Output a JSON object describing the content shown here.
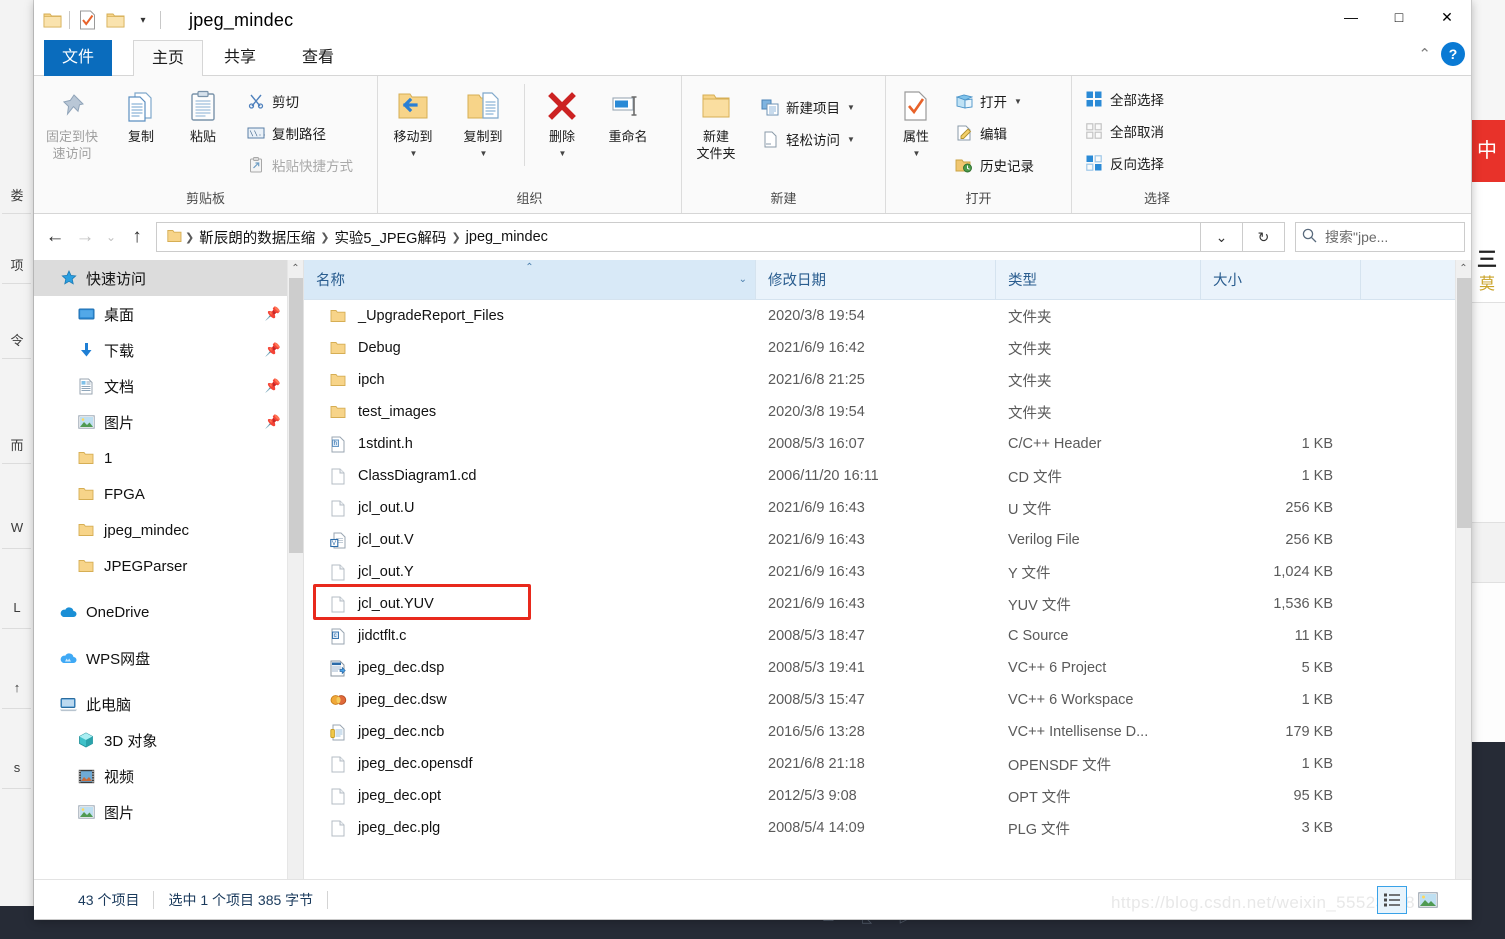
{
  "window": {
    "title": "jpeg_mindec",
    "quick_access_icons": [
      "folder-icon",
      "properties-icon",
      "folder-icon",
      "chevron-down-icon"
    ],
    "controls": {
      "minimize": "—",
      "maximize": "□",
      "close": "✕"
    }
  },
  "ribbon": {
    "tabs": [
      {
        "label": "文件",
        "kind": "file",
        "active": false
      },
      {
        "label": "主页",
        "kind": "normal",
        "active": true
      },
      {
        "label": "共享",
        "kind": "normal",
        "active": false
      },
      {
        "label": "查看",
        "kind": "normal",
        "active": false
      }
    ],
    "collapse_icon": "chevron-up-icon",
    "help_icon": "help-icon",
    "help_label": "?",
    "groups": [
      {
        "name": "clipboard",
        "label": "剪贴板",
        "big": [
          {
            "label": "固定到快\n速访问",
            "line1": "固定到快",
            "line2": "速访问",
            "icon": "pin-icon",
            "dim": true
          },
          {
            "label": "复制",
            "line1": "复制",
            "line2": "",
            "icon": "copy-icon",
            "dim": false
          },
          {
            "label": "粘贴",
            "line1": "粘贴",
            "line2": "",
            "icon": "paste-icon",
            "dim": false
          }
        ],
        "small": [
          {
            "label": "剪切",
            "icon": "scissors-icon",
            "dim": false
          },
          {
            "label": "复制路径",
            "icon": "copy-path-icon",
            "dim": false
          },
          {
            "label": "粘贴快捷方式",
            "icon": "paste-shortcut-icon",
            "dim": true
          }
        ]
      },
      {
        "name": "organize",
        "label": "组织",
        "big": [
          {
            "label": "移动到",
            "line1": "移动到",
            "line2": "",
            "icon": "move-to-icon",
            "dropdown": true
          },
          {
            "label": "复制到",
            "line1": "复制到",
            "line2": "",
            "icon": "copy-to-icon",
            "dropdown": true
          },
          {
            "label": "删除",
            "line1": "删除",
            "line2": "",
            "icon": "delete-icon",
            "dropdown": true
          },
          {
            "label": "重命名",
            "line1": "重命名",
            "line2": "",
            "icon": "rename-icon",
            "dropdown": false
          }
        ],
        "small": []
      },
      {
        "name": "new",
        "label": "新建",
        "big": [
          {
            "label": "新建\n文件夹",
            "line1": "新建",
            "line2": "文件夹",
            "icon": "new-folder-icon",
            "dim": false
          }
        ],
        "small": [
          {
            "label": "新建项目",
            "icon": "new-item-icon",
            "dropdown": true
          },
          {
            "label": "轻松访问",
            "icon": "easy-access-icon",
            "dropdown": true
          }
        ]
      },
      {
        "name": "open",
        "label": "打开",
        "big": [
          {
            "label": "属性",
            "line1": "属性",
            "line2": "",
            "icon": "properties-icon",
            "dropdown": true
          }
        ],
        "small": [
          {
            "label": "打开",
            "icon": "open-icon",
            "dropdown": true
          },
          {
            "label": "编辑",
            "icon": "edit-icon",
            "dropdown": false
          },
          {
            "label": "历史记录",
            "icon": "history-icon",
            "dropdown": false
          }
        ]
      },
      {
        "name": "select",
        "label": "选择",
        "big": [],
        "small": [
          {
            "label": "全部选择",
            "icon": "select-all-icon",
            "dim": false
          },
          {
            "label": "全部取消",
            "icon": "select-none-icon",
            "dim": true
          },
          {
            "label": "反向选择",
            "icon": "invert-selection-icon",
            "dim": false
          }
        ]
      }
    ]
  },
  "address": {
    "back_icon": "arrow-left-icon",
    "forward_icon": "arrow-right-icon",
    "recent_icon": "chevron-down-icon",
    "up_icon": "arrow-up-icon",
    "root_icon": "folder-icon",
    "breadcrumbs": [
      "靳辰朗的数据压缩",
      "实验5_JPEG解码",
      "jpeg_mindec"
    ],
    "separator": "❯",
    "dropdown_icon": "chevron-down-icon",
    "refresh_icon": "refresh-icon",
    "refresh_glyph": "↻"
  },
  "search": {
    "icon": "search-icon",
    "placeholder": "搜索\"jpe..."
  },
  "nav_pane": {
    "items": [
      {
        "label": "快速访问",
        "icon": "star-icon",
        "selected": true,
        "pinned": false,
        "indent": false,
        "spacer_before": false
      },
      {
        "label": "桌面",
        "icon": "desktop-icon",
        "selected": false,
        "pinned": true,
        "indent": true,
        "spacer_before": false
      },
      {
        "label": "下载",
        "icon": "downloads-icon",
        "selected": false,
        "pinned": true,
        "indent": true,
        "spacer_before": false
      },
      {
        "label": "文档",
        "icon": "documents-icon",
        "selected": false,
        "pinned": true,
        "indent": true,
        "spacer_before": false
      },
      {
        "label": "图片",
        "icon": "pictures-icon",
        "selected": false,
        "pinned": true,
        "indent": true,
        "spacer_before": false
      },
      {
        "label": "1",
        "icon": "folder-icon",
        "selected": false,
        "pinned": false,
        "indent": true,
        "spacer_before": false
      },
      {
        "label": "FPGA",
        "icon": "folder-icon",
        "selected": false,
        "pinned": false,
        "indent": true,
        "spacer_before": false
      },
      {
        "label": "jpeg_mindec",
        "icon": "folder-icon",
        "selected": false,
        "pinned": false,
        "indent": true,
        "spacer_before": false
      },
      {
        "label": "JPEGParser",
        "icon": "folder-icon",
        "selected": false,
        "pinned": false,
        "indent": true,
        "spacer_before": false
      },
      {
        "label": "OneDrive",
        "icon": "onedrive-icon",
        "selected": false,
        "pinned": false,
        "indent": false,
        "spacer_before": true
      },
      {
        "label": "WPS网盘",
        "icon": "wps-cloud-icon",
        "selected": false,
        "pinned": false,
        "indent": false,
        "spacer_before": true
      },
      {
        "label": "此电脑",
        "icon": "this-pc-icon",
        "selected": false,
        "pinned": false,
        "indent": false,
        "spacer_before": true
      },
      {
        "label": "3D 对象",
        "icon": "3d-objects-icon",
        "selected": false,
        "pinned": false,
        "indent": true,
        "spacer_before": false
      },
      {
        "label": "视频",
        "icon": "videos-icon",
        "selected": false,
        "pinned": false,
        "indent": true,
        "spacer_before": false
      },
      {
        "label": "图片",
        "icon": "pictures-icon",
        "selected": false,
        "pinned": false,
        "indent": true,
        "spacer_before": false
      }
    ],
    "scroll_up_icon": "chevron-up-icon",
    "scroll_down_icon": "chevron-down-icon"
  },
  "file_list": {
    "columns": [
      {
        "label": "名称",
        "sorted": true,
        "sort_dir": "asc",
        "has_dropdown": true
      },
      {
        "label": "修改日期",
        "sorted": false
      },
      {
        "label": "类型",
        "sorted": false
      },
      {
        "label": "大小",
        "sorted": false
      }
    ],
    "rows": [
      {
        "name": "_UpgradeReport_Files",
        "date": "2020/3/8 19:54",
        "type": "文件夹",
        "size": "",
        "icon": "folder-icon",
        "highlight": false
      },
      {
        "name": "Debug",
        "date": "2021/6/9 16:42",
        "type": "文件夹",
        "size": "",
        "icon": "folder-icon",
        "highlight": false
      },
      {
        "name": "ipch",
        "date": "2021/6/8 21:25",
        "type": "文件夹",
        "size": "",
        "icon": "folder-icon",
        "highlight": false
      },
      {
        "name": "test_images",
        "date": "2020/3/8 19:54",
        "type": "文件夹",
        "size": "",
        "icon": "folder-icon",
        "highlight": false
      },
      {
        "name": "1stdint.h",
        "date": "2008/5/3 16:07",
        "type": "C/C++ Header",
        "size": "1 KB",
        "icon": "header-file-icon",
        "highlight": false
      },
      {
        "name": "ClassDiagram1.cd",
        "date": "2006/11/20 16:11",
        "type": "CD 文件",
        "size": "1 KB",
        "icon": "blank-file-icon",
        "highlight": false
      },
      {
        "name": "jcl_out.U",
        "date": "2021/6/9 16:43",
        "type": "U 文件",
        "size": "256 KB",
        "icon": "blank-file-icon",
        "highlight": false
      },
      {
        "name": "jcl_out.V",
        "date": "2021/6/9 16:43",
        "type": "Verilog File",
        "size": "256 KB",
        "icon": "verilog-file-icon",
        "highlight": false
      },
      {
        "name": "jcl_out.Y",
        "date": "2021/6/9 16:43",
        "type": "Y 文件",
        "size": "1,024 KB",
        "icon": "blank-file-icon",
        "highlight": false
      },
      {
        "name": "jcl_out.YUV",
        "date": "2021/6/9 16:43",
        "type": "YUV 文件",
        "size": "1,536 KB",
        "icon": "blank-file-icon",
        "highlight": true
      },
      {
        "name": "jidctflt.c",
        "date": "2008/5/3 18:47",
        "type": "C Source",
        "size": "11 KB",
        "icon": "c-source-icon",
        "highlight": false
      },
      {
        "name": "jpeg_dec.dsp",
        "date": "2008/5/3 19:41",
        "type": "VC++ 6 Project",
        "size": "5 KB",
        "icon": "vc-project-icon",
        "highlight": false
      },
      {
        "name": "jpeg_dec.dsw",
        "date": "2008/5/3 15:47",
        "type": "VC++ 6 Workspace",
        "size": "1 KB",
        "icon": "vc-workspace-icon",
        "highlight": false
      },
      {
        "name": "jpeg_dec.ncb",
        "date": "2016/5/6 13:28",
        "type": "VC++ Intellisense D...",
        "size": "179 KB",
        "icon": "ncb-file-icon",
        "highlight": false
      },
      {
        "name": "jpeg_dec.opensdf",
        "date": "2021/6/8 21:18",
        "type": "OPENSDF 文件",
        "size": "1 KB",
        "icon": "blank-file-icon",
        "highlight": false
      },
      {
        "name": "jpeg_dec.opt",
        "date": "2012/5/3 9:08",
        "type": "OPT 文件",
        "size": "95 KB",
        "icon": "blank-file-icon",
        "highlight": false
      },
      {
        "name": "jpeg_dec.plg",
        "date": "2008/5/4 14:09",
        "type": "PLG 文件",
        "size": "3 KB",
        "icon": "blank-file-icon",
        "highlight": false
      }
    ],
    "scroll_up_icon": "chevron-up-icon",
    "scroll_down_icon": "chevron-down-icon"
  },
  "status_bar": {
    "item_count": "43 个项目",
    "selection_info": "选中 1 个项目  385 字节",
    "view_details_icon": "details-view-icon",
    "view_thumbnails_icon": "thumbnail-view-icon"
  },
  "watermark": {
    "text": "https://blog.csdn.net/weixin_55523848"
  },
  "background": {
    "left_strip_glyphs": [
      "娄",
      "项",
      "令",
      "而",
      "W",
      "L",
      "↑",
      "s"
    ],
    "right_panel_glyphs": [
      "中",
      "三",
      "莫"
    ]
  },
  "colors": {
    "accent": "#0a6cbd",
    "header_bg": "#eaf3fb",
    "highlight_red": "#e8291c",
    "selection_gray": "#dcdcdc",
    "folder_yellow": "#f5c96a"
  }
}
